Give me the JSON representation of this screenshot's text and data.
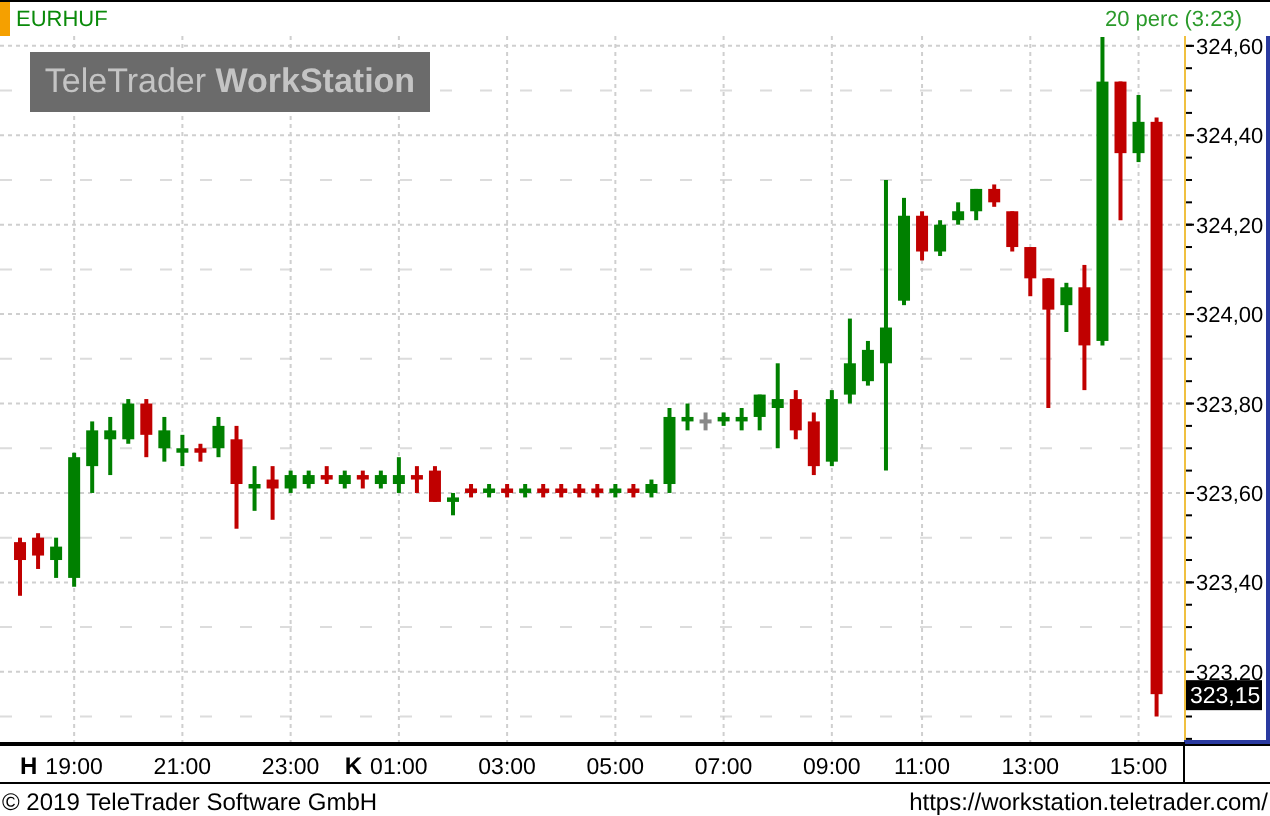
{
  "header": {
    "symbol": "EURHUF",
    "interval": "20 perc (3:23)"
  },
  "logo": {
    "text": "TeleTrader **WorkStation**"
  },
  "chart": {
    "chart_data": {
      "type": "candlestick",
      "grid": true,
      "ylim": [
        323.043,
        324.622
      ],
      "categories": [
        "H",
        null,
        null,
        "19:00",
        null,
        null,
        null,
        null,
        null,
        "21:00",
        null,
        null,
        null,
        null,
        null,
        "23:00",
        null,
        null,
        "K",
        null,
        null,
        "01:00",
        null,
        null,
        null,
        null,
        null,
        "03:00",
        null,
        null,
        null,
        null,
        null,
        "05:00",
        null,
        null,
        null,
        null,
        null,
        "07:00",
        null,
        null,
        null,
        null,
        null,
        "09:00",
        null,
        null,
        null,
        null,
        "11:00",
        null,
        null,
        null,
        null,
        null,
        "13:00",
        null,
        null,
        null,
        null,
        null,
        "15:00",
        null
      ],
      "ohlc": [
        [
          323.49,
          323.5,
          323.37,
          323.45
        ],
        [
          323.5,
          323.51,
          323.43,
          323.46
        ],
        [
          323.45,
          323.5,
          323.41,
          323.48
        ],
        [
          323.41,
          323.69,
          323.39,
          323.68
        ],
        [
          323.66,
          323.76,
          323.6,
          323.74
        ],
        [
          323.72,
          323.77,
          323.64,
          323.74
        ],
        [
          323.72,
          323.81,
          323.71,
          323.8
        ],
        [
          323.8,
          323.81,
          323.68,
          323.73
        ],
        [
          323.7,
          323.77,
          323.67,
          323.74
        ],
        [
          323.69,
          323.73,
          323.66,
          323.7
        ],
        [
          323.7,
          323.71,
          323.67,
          323.69
        ],
        [
          323.7,
          323.77,
          323.68,
          323.75
        ],
        [
          323.72,
          323.75,
          323.52,
          323.62
        ],
        [
          323.61,
          323.66,
          323.56,
          323.62
        ],
        [
          323.63,
          323.66,
          323.54,
          323.61
        ],
        [
          323.61,
          323.65,
          323.6,
          323.64
        ],
        [
          323.62,
          323.65,
          323.61,
          323.64
        ],
        [
          323.64,
          323.66,
          323.62,
          323.63
        ],
        [
          323.62,
          323.65,
          323.61,
          323.64
        ],
        [
          323.64,
          323.65,
          323.61,
          323.63
        ],
        [
          323.62,
          323.65,
          323.61,
          323.64
        ],
        [
          323.62,
          323.68,
          323.6,
          323.64
        ],
        [
          323.64,
          323.66,
          323.6,
          323.63
        ],
        [
          323.65,
          323.66,
          323.58,
          323.58
        ],
        [
          323.58,
          323.6,
          323.55,
          323.59
        ],
        [
          323.61,
          323.62,
          323.59,
          323.6
        ],
        [
          323.6,
          323.62,
          323.59,
          323.61
        ],
        [
          323.61,
          323.62,
          323.59,
          323.6
        ],
        [
          323.6,
          323.62,
          323.59,
          323.61
        ],
        [
          323.61,
          323.62,
          323.59,
          323.6
        ],
        [
          323.61,
          323.62,
          323.59,
          323.6
        ],
        [
          323.61,
          323.62,
          323.59,
          323.6
        ],
        [
          323.61,
          323.62,
          323.59,
          323.6
        ],
        [
          323.6,
          323.62,
          323.59,
          323.61
        ],
        [
          323.61,
          323.62,
          323.59,
          323.6
        ],
        [
          323.6,
          323.63,
          323.59,
          323.62
        ],
        [
          323.62,
          323.79,
          323.6,
          323.77
        ],
        [
          323.76,
          323.8,
          323.74,
          323.77
        ],
        [
          323.76,
          323.78,
          323.74,
          323.76
        ],
        [
          323.76,
          323.78,
          323.75,
          323.77
        ],
        [
          323.76,
          323.79,
          323.74,
          323.77
        ],
        [
          323.77,
          323.82,
          323.74,
          323.82
        ],
        [
          323.79,
          323.89,
          323.7,
          323.81
        ],
        [
          323.81,
          323.83,
          323.72,
          323.74
        ],
        [
          323.76,
          323.78,
          323.64,
          323.66
        ],
        [
          323.67,
          323.83,
          323.66,
          323.81
        ],
        [
          323.82,
          323.99,
          323.8,
          323.89
        ],
        [
          323.85,
          323.94,
          323.84,
          323.92
        ],
        [
          323.89,
          324.3,
          323.65,
          323.97
        ],
        [
          324.03,
          324.26,
          324.02,
          324.22
        ],
        [
          324.22,
          324.23,
          324.12,
          324.14
        ],
        [
          324.14,
          324.21,
          324.13,
          324.2
        ],
        [
          324.21,
          324.25,
          324.2,
          324.23
        ],
        [
          324.23,
          324.28,
          324.21,
          324.28
        ],
        [
          324.28,
          324.29,
          324.24,
          324.25
        ],
        [
          324.23,
          324.23,
          324.14,
          324.15
        ],
        [
          324.15,
          324.15,
          324.04,
          324.08
        ],
        [
          324.08,
          324.08,
          323.79,
          324.01
        ],
        [
          324.02,
          324.07,
          323.96,
          324.06
        ],
        [
          324.06,
          324.11,
          323.83,
          323.93
        ],
        [
          323.94,
          324.62,
          323.93,
          324.52
        ],
        [
          324.52,
          324.52,
          324.21,
          324.36
        ],
        [
          324.36,
          324.49,
          324.34,
          324.43
        ],
        [
          324.43,
          324.44,
          323.1,
          323.15
        ]
      ],
      "yticks": [
        {
          "value": 323.2,
          "label": "323,20"
        },
        {
          "value": 323.4,
          "label": "323,40"
        },
        {
          "value": 323.6,
          "label": "323,60"
        },
        {
          "value": 323.8,
          "label": "323,80"
        },
        {
          "value": 324.0,
          "label": "324,00"
        },
        {
          "value": 324.2,
          "label": "324,20"
        },
        {
          "value": 324.4,
          "label": "324,40"
        },
        {
          "value": 324.6,
          "label": "324,60"
        }
      ],
      "annotations": [
        {
          "y": 323.15,
          "text": "323,15"
        }
      ]
    }
  },
  "footer": {
    "copyright": "© 2019 TeleTrader Software GmbH",
    "url": "https://workstation.teletrader.com/"
  }
}
